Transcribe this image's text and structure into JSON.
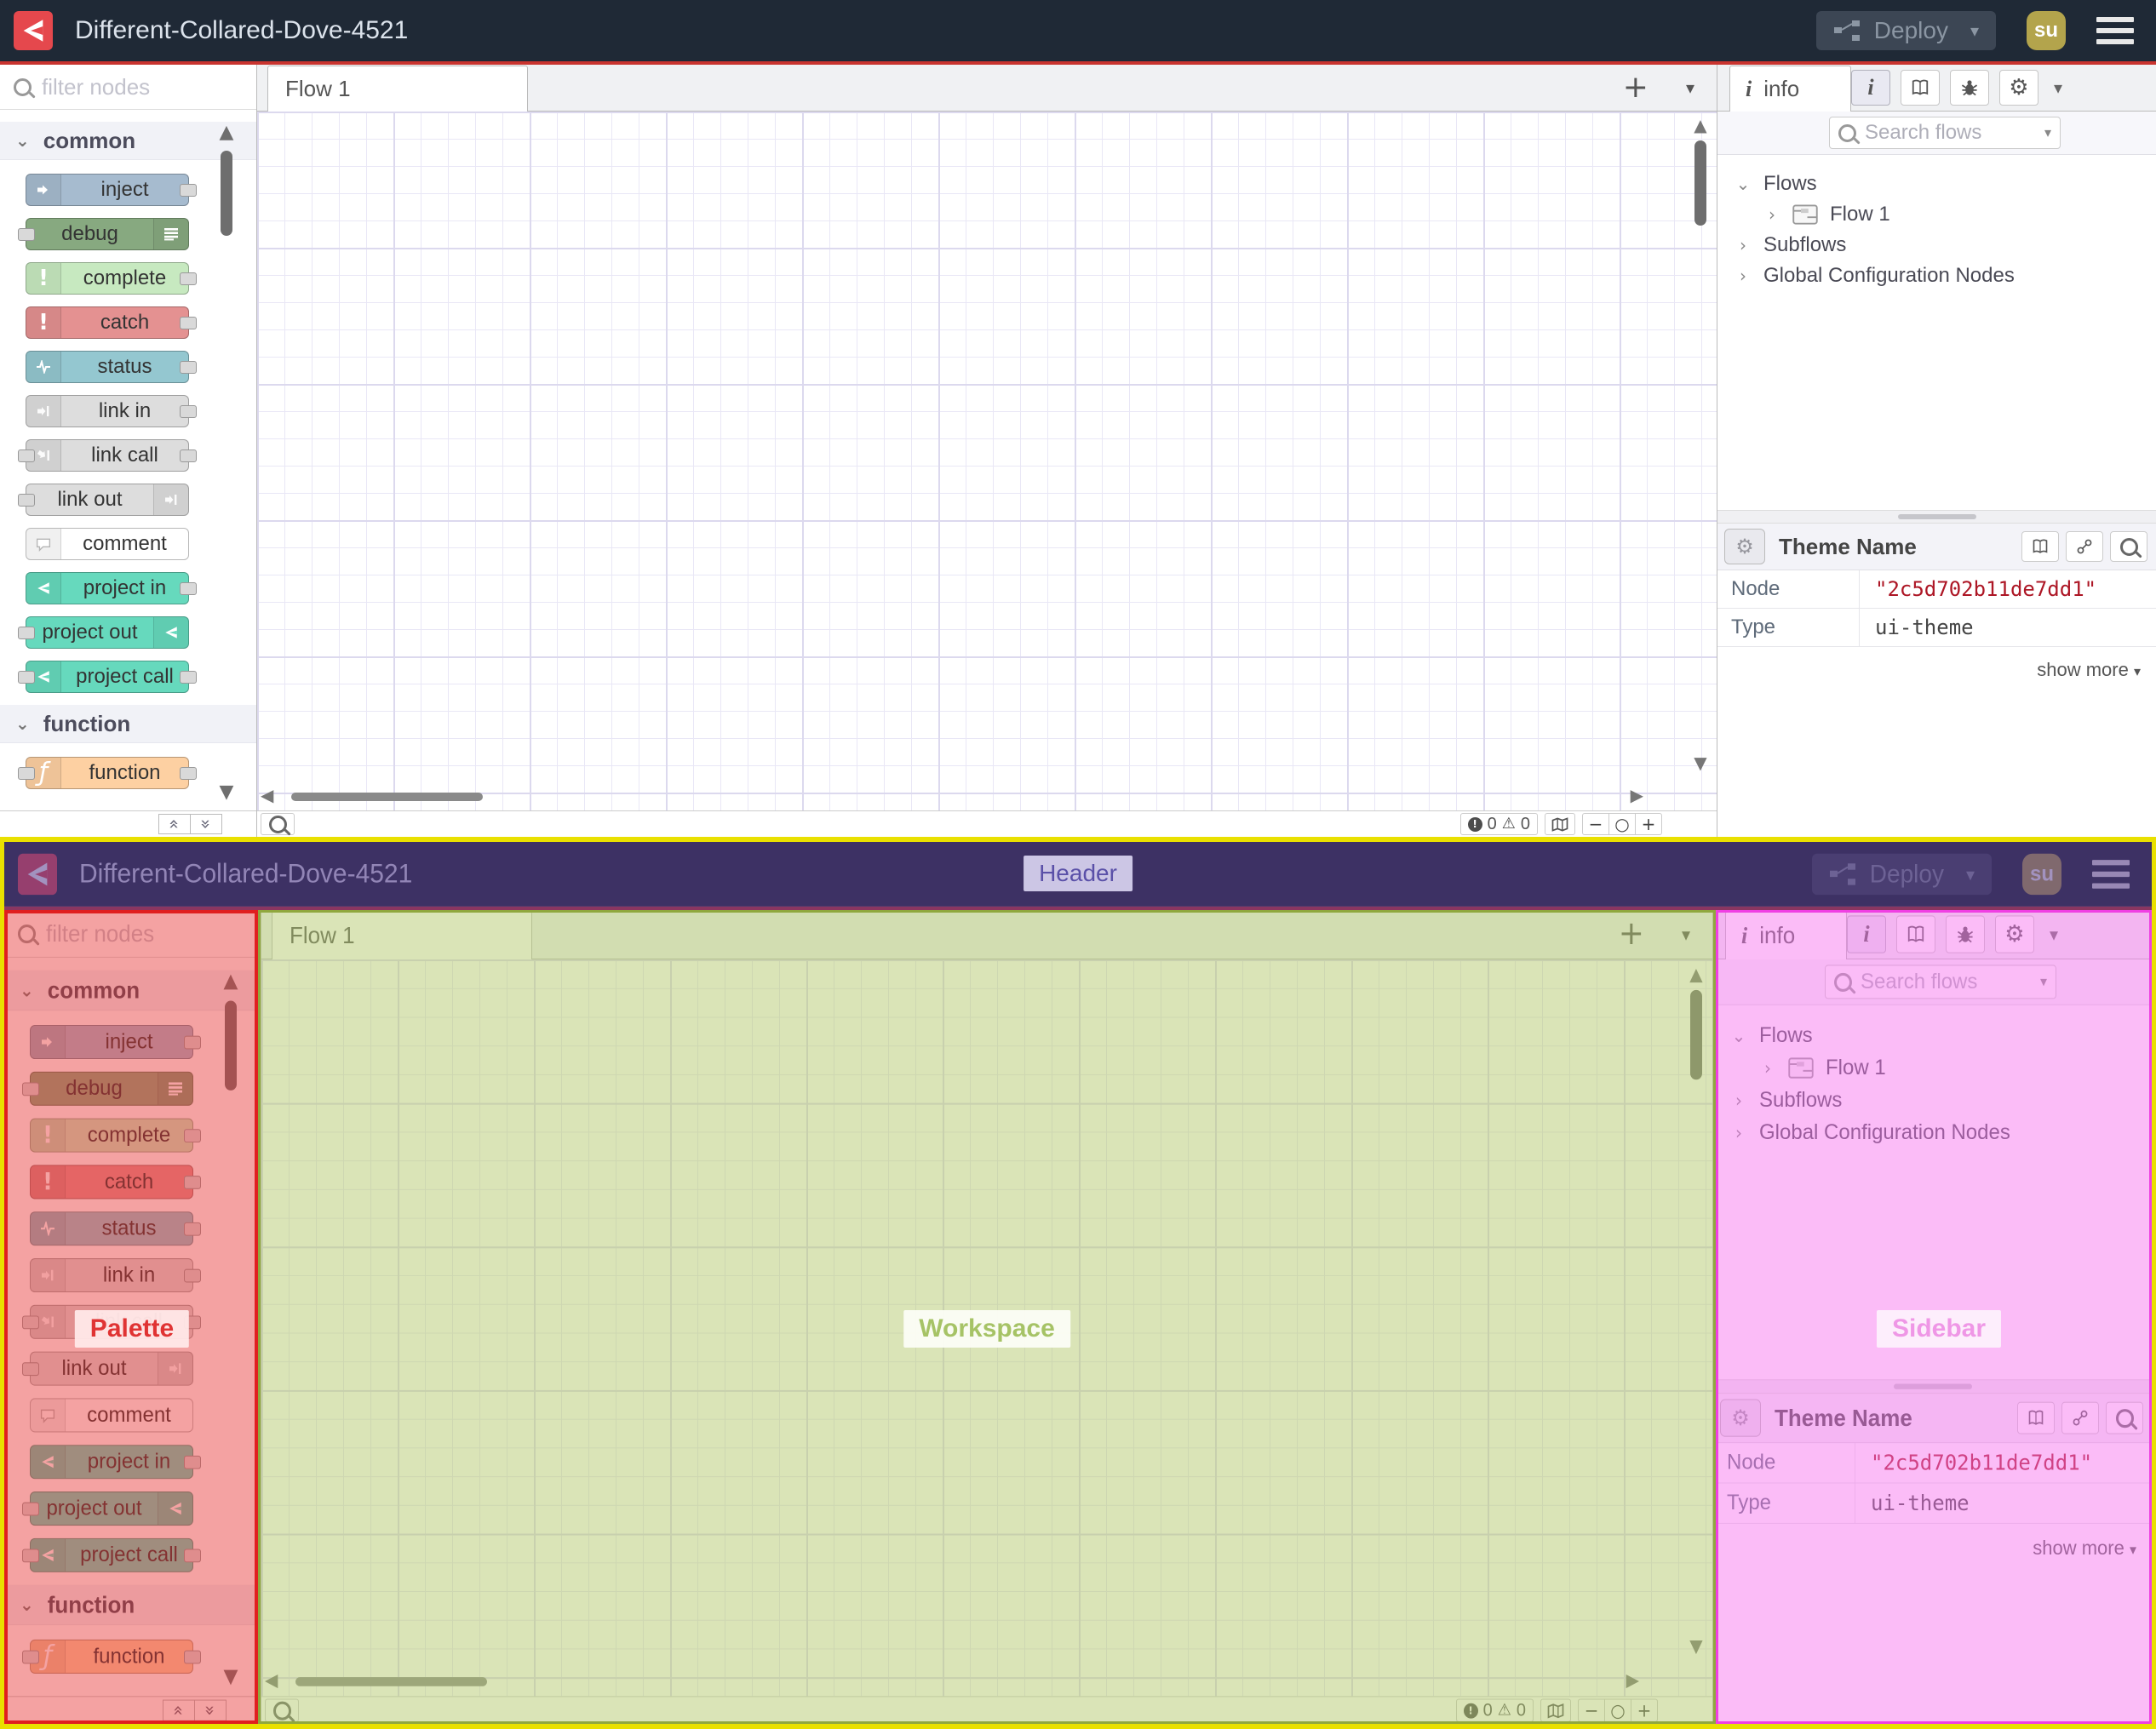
{
  "header": {
    "title": "Different-Collared-Dove-4521",
    "deploy_label": "Deploy",
    "avatar_text": "su"
  },
  "palette": {
    "search_placeholder": "filter nodes",
    "categories": [
      {
        "label": "common"
      },
      {
        "label": "function"
      }
    ],
    "nodes": {
      "inject": "inject",
      "debug": "debug",
      "complete": "complete",
      "catch": "catch",
      "status": "status",
      "link_in": "link in",
      "link_call": "link call",
      "link_out": "link out",
      "comment": "comment",
      "project_in": "project in",
      "project_out": "project out",
      "project_call": "project call",
      "function": "function"
    }
  },
  "workspace": {
    "tab_label": "Flow 1",
    "status": {
      "errors": "0",
      "warnings": "0"
    }
  },
  "sidebar": {
    "tab_label": "info",
    "search_placeholder": "Search flows",
    "tree": {
      "flows_label": "Flows",
      "flow1_label": "Flow 1",
      "subflows_label": "Subflows",
      "global_config_label": "Global Configuration Nodes"
    },
    "info_panel": {
      "title": "Theme Name",
      "rows": [
        {
          "label": "Node",
          "value": "\"2c5d702b11de7dd1\""
        },
        {
          "label": "Type",
          "value": "ui-theme"
        }
      ],
      "show_more_label": "show more"
    }
  },
  "annotations": {
    "header": "Header",
    "palette": "Palette",
    "workspace": "Workspace",
    "sidebar": "Sidebar"
  },
  "icons": {
    "caret_down": "▾",
    "chevron_down": "⌄",
    "chevron_right": "›",
    "plus": "+",
    "minus": "−",
    "zoom_reset": "○",
    "warning": "⚠",
    "gear": "⚙",
    "scroll_up": "▲",
    "scroll_down": "▼",
    "scroll_left": "◀",
    "scroll_right": "▶",
    "collapse_all": "«",
    "expand_all": "»",
    "exclamation": "!",
    "function_glyph": "ƒ",
    "info_glyph": "i"
  },
  "colors": {
    "header_bg": "#1f2936",
    "logo_red": "#e5484d",
    "header_divider_red": "#c9342f",
    "avatar_bg": "#b3a44c",
    "node_inject": "#a6bbcf",
    "node_debug": "#87a980",
    "node_complete": "#c7e9c0",
    "node_catch": "#e49191",
    "node_status": "#94c7d0",
    "node_link": "#dddddd",
    "node_comment": "#ffffff",
    "node_project": "#66d9bd",
    "node_function": "#fdd0a2",
    "value_red": "#ad1625",
    "annotation_yellow": "#e9e000",
    "annotation_header_purple": "#55398a",
    "annotation_palette_red": "#e01f1f",
    "annotation_workspace_green": "#90a73e",
    "annotation_sidebar_pink": "#f03fe3"
  }
}
